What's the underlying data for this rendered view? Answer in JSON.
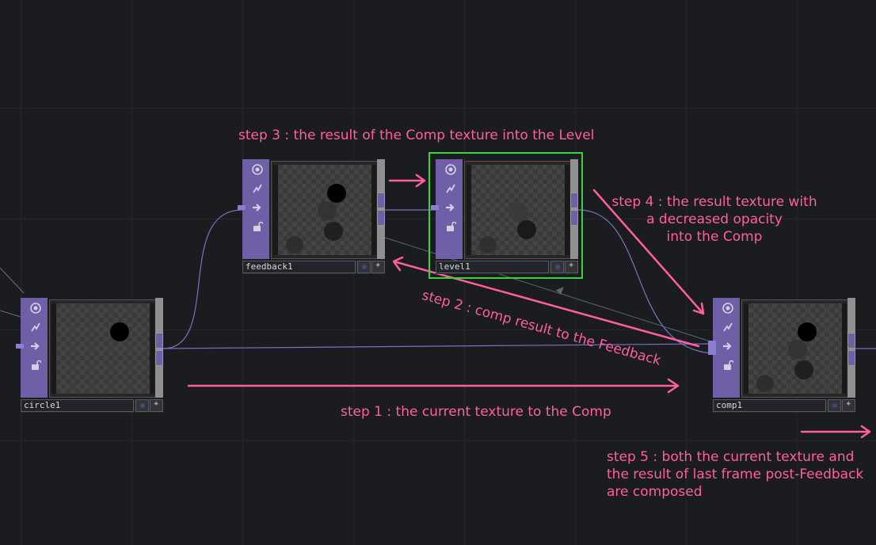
{
  "nodes": {
    "circle1": {
      "name": "circle1"
    },
    "feedback1": {
      "name": "feedback1"
    },
    "level1": {
      "name": "level1"
    },
    "comp1": {
      "name": "comp1"
    }
  },
  "node_icons": [
    "viewer-active-icon",
    "bypass-icon",
    "cook-arrow-icon",
    "lock-icon"
  ],
  "annotations": {
    "step1": "step 1 : the current texture to the Comp",
    "step2": "step 2 : comp result to the Feedback",
    "step3": "step 3 : the result of the Comp texture into the Level",
    "step4_line1": "step 4 : the result texture with",
    "step4_line2": "a decreased opacity",
    "step4_line3": "into the Comp",
    "step5_line1": "step 5 : both the current texture and",
    "step5_line2": "the result of last frame post-Feedback",
    "step5_line3": "are composed"
  },
  "colors": {
    "background": "#1b1c20",
    "node_accent": "#6e5fa6",
    "annotation": "#ff5fa0",
    "selection": "#39d33a",
    "wire": "#8c7fd0"
  }
}
